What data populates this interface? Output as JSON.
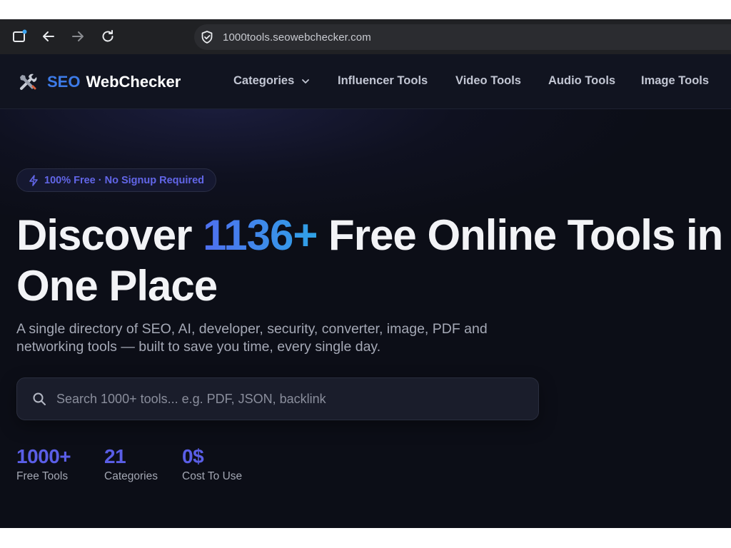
{
  "browser": {
    "url": "1000tools.seowebchecker.com"
  },
  "site": {
    "logo": {
      "seo": "SEO",
      "webchecker": "WebChecker"
    },
    "nav": [
      {
        "label": "Categories"
      },
      {
        "label": "Influencer Tools"
      },
      {
        "label": "Video Tools"
      },
      {
        "label": "Audio Tools"
      },
      {
        "label": "Image Tools"
      }
    ],
    "badge": "100% Free · No Signup Required",
    "hero": {
      "title_pre": "Discover ",
      "title_highlight": "1136+",
      "title_post": " Free Online Tools in",
      "title_line2": "One Place",
      "subtitle_line1": "A single directory of SEO, AI, developer, security, converter, image, PDF and",
      "subtitle_line2": "networking tools — built to save you time, every single day."
    },
    "search": {
      "placeholder": "Search 1000+ tools... e.g. PDF, JSON, backlink",
      "value": ""
    },
    "stats": [
      {
        "value": "1000+",
        "label": "Free Tools"
      },
      {
        "value": "21",
        "label": "Categories"
      },
      {
        "value": "0$",
        "label": "Cost To Use"
      }
    ]
  },
  "colors": {
    "accent": "#5a5ee6",
    "brand_blue": "#3d7be8",
    "background": "#0f1120"
  },
  "icons": [
    "tab-icon",
    "back-arrow-icon",
    "forward-arrow-icon",
    "reload-icon",
    "shield-icon",
    "tools-icon",
    "chevron-down-icon",
    "lightning-icon",
    "search-icon"
  ]
}
